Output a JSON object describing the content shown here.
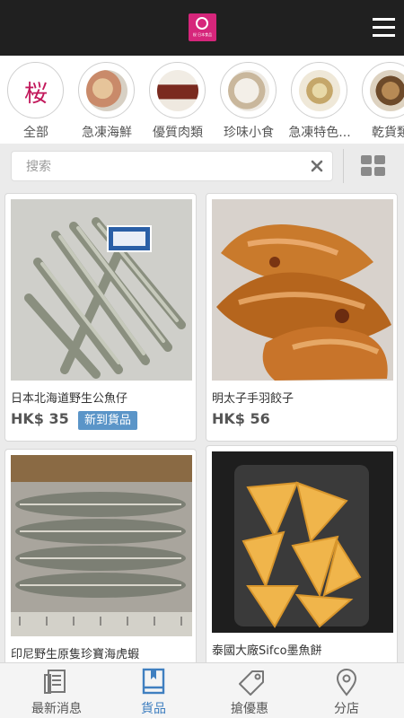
{
  "header": {
    "logo_text": "桜 日本食品",
    "logo_icon": "sakura-logo",
    "menu_icon": "hamburger-menu-icon"
  },
  "categories": [
    {
      "label": "全部",
      "icon_text": "桜"
    },
    {
      "label": "急凍海鮮"
    },
    {
      "label": "優質肉類"
    },
    {
      "label": "珍味小食"
    },
    {
      "label": "急凍特色..."
    },
    {
      "label": "乾貨類"
    }
  ],
  "search": {
    "placeholder": "搜索",
    "clear_icon": "close-icon",
    "view_icon": "grid-view-icon"
  },
  "products": [
    {
      "name": "日本北海道野生公魚仔",
      "price": "HK$ 35",
      "badge": "新到貨品"
    },
    {
      "name": "明太子手羽餃子",
      "price": "HK$ 56"
    },
    {
      "name": "印尼野生原隻珍寶海虎蝦"
    },
    {
      "name": "泰國大廠Sifco墨魚餅"
    }
  ],
  "tabbar": {
    "tabs": [
      {
        "label": "最新消息",
        "icon": "news-icon"
      },
      {
        "label": "貨品",
        "icon": "book-icon"
      },
      {
        "label": "搶優惠",
        "icon": "tag-icon"
      },
      {
        "label": "分店",
        "icon": "location-pin-icon"
      }
    ],
    "active_tab": "貨品"
  },
  "colors": {
    "header_bg": "#202020",
    "brand_pink": "#d6267b",
    "accent_blue": "#3f7fc0",
    "badge_blue": "#5b95c8"
  }
}
